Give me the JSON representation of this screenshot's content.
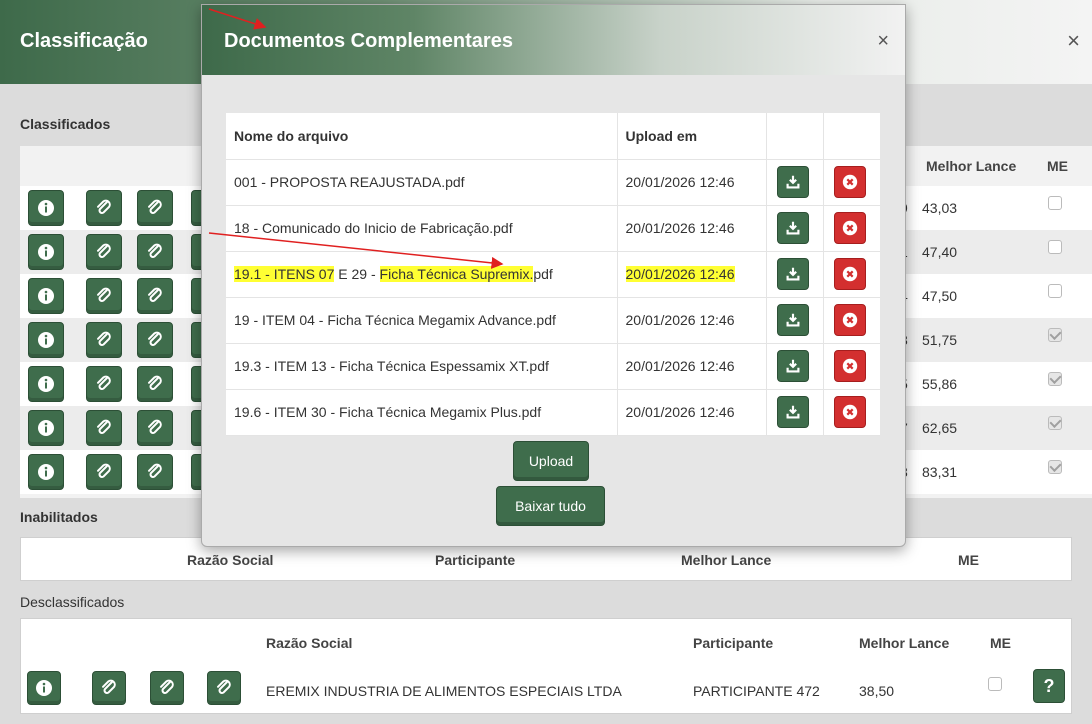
{
  "background_window": {
    "title": "Classificação",
    "close_icon": "×",
    "classified_label": "Classificados",
    "classified_header": {
      "best_bid": "Melhor Lance",
      "me": "ME"
    },
    "classified_rows": [
      {
        "participant_suffix": "9",
        "best_bid": "43,03",
        "me_checked": false
      },
      {
        "participant_suffix": "1",
        "best_bid": "47,40",
        "me_checked": false
      },
      {
        "participant_suffix": "4",
        "best_bid": "47,50",
        "me_checked": false
      },
      {
        "participant_suffix": "3",
        "best_bid": "51,75",
        "me_checked": true
      },
      {
        "participant_suffix": "5",
        "best_bid": "55,86",
        "me_checked": true
      },
      {
        "participant_suffix": "7",
        "best_bid": "62,65",
        "me_checked": true
      },
      {
        "participant_suffix": "3",
        "best_bid": "83,31",
        "me_checked": true
      }
    ],
    "disabled_label": "Inabilitados",
    "disabled_header": {
      "company": "Razão Social",
      "participant": "Participante",
      "best_bid": "Melhor Lance",
      "me": "ME"
    },
    "disqualified_label": "Desclassificados",
    "disqualified_header": {
      "company": "Razão Social",
      "participant": "Participante",
      "best_bid": "Melhor Lance",
      "me": "ME"
    },
    "disqualified_row": {
      "company": "EREMIX INDUSTRIA DE ALIMENTOS ESPECIAIS LTDA",
      "participant": "PARTICIPANTE 472",
      "best_bid": "38,50",
      "me_checked": false,
      "help_label": "?"
    }
  },
  "modal": {
    "title": "Documentos Complementares",
    "close_icon": "×",
    "table_header": {
      "file_name": "Nome do arquivo",
      "upload_date": "Upload em"
    },
    "files": [
      {
        "name": "001 - PROPOSTA REAJUSTADA.pdf",
        "uploaded": "20/01/2026 12:46"
      },
      {
        "name": "18 - Comunicado do Inicio de Fabricação.pdf",
        "uploaded": "20/01/2026 12:46"
      },
      {
        "name_parts": [
          "19.1 - ITENS 07",
          " E 29 - ",
          "Ficha Técnica Supremix.",
          "pdf"
        ],
        "uploaded": "20/01/2026 12:46"
      },
      {
        "name": "19 - ITEM 04 - Ficha Técnica Megamix Advance.pdf",
        "uploaded": "20/01/2026 12:46"
      },
      {
        "name": "19.3 - ITEM 13 - Ficha Técnica Espessamix XT.pdf",
        "uploaded": "20/01/2026 12:46"
      },
      {
        "name": "19.6 - ITEM 30 - Ficha Técnica Megamix Plus.pdf",
        "uploaded": "20/01/2026 12:46"
      }
    ],
    "upload_label": "Upload",
    "download_all_label": "Baixar tudo"
  },
  "colors": {
    "primary_green": "#3f6d4c",
    "danger_red": "#d32f2f",
    "highlight": "#ffff33",
    "annotation_arrow": "#e02020"
  },
  "icons": {
    "info": "info-icon",
    "attachment": "paperclip-icon",
    "download": "download-icon",
    "delete": "delete-icon",
    "help": "question-icon"
  }
}
